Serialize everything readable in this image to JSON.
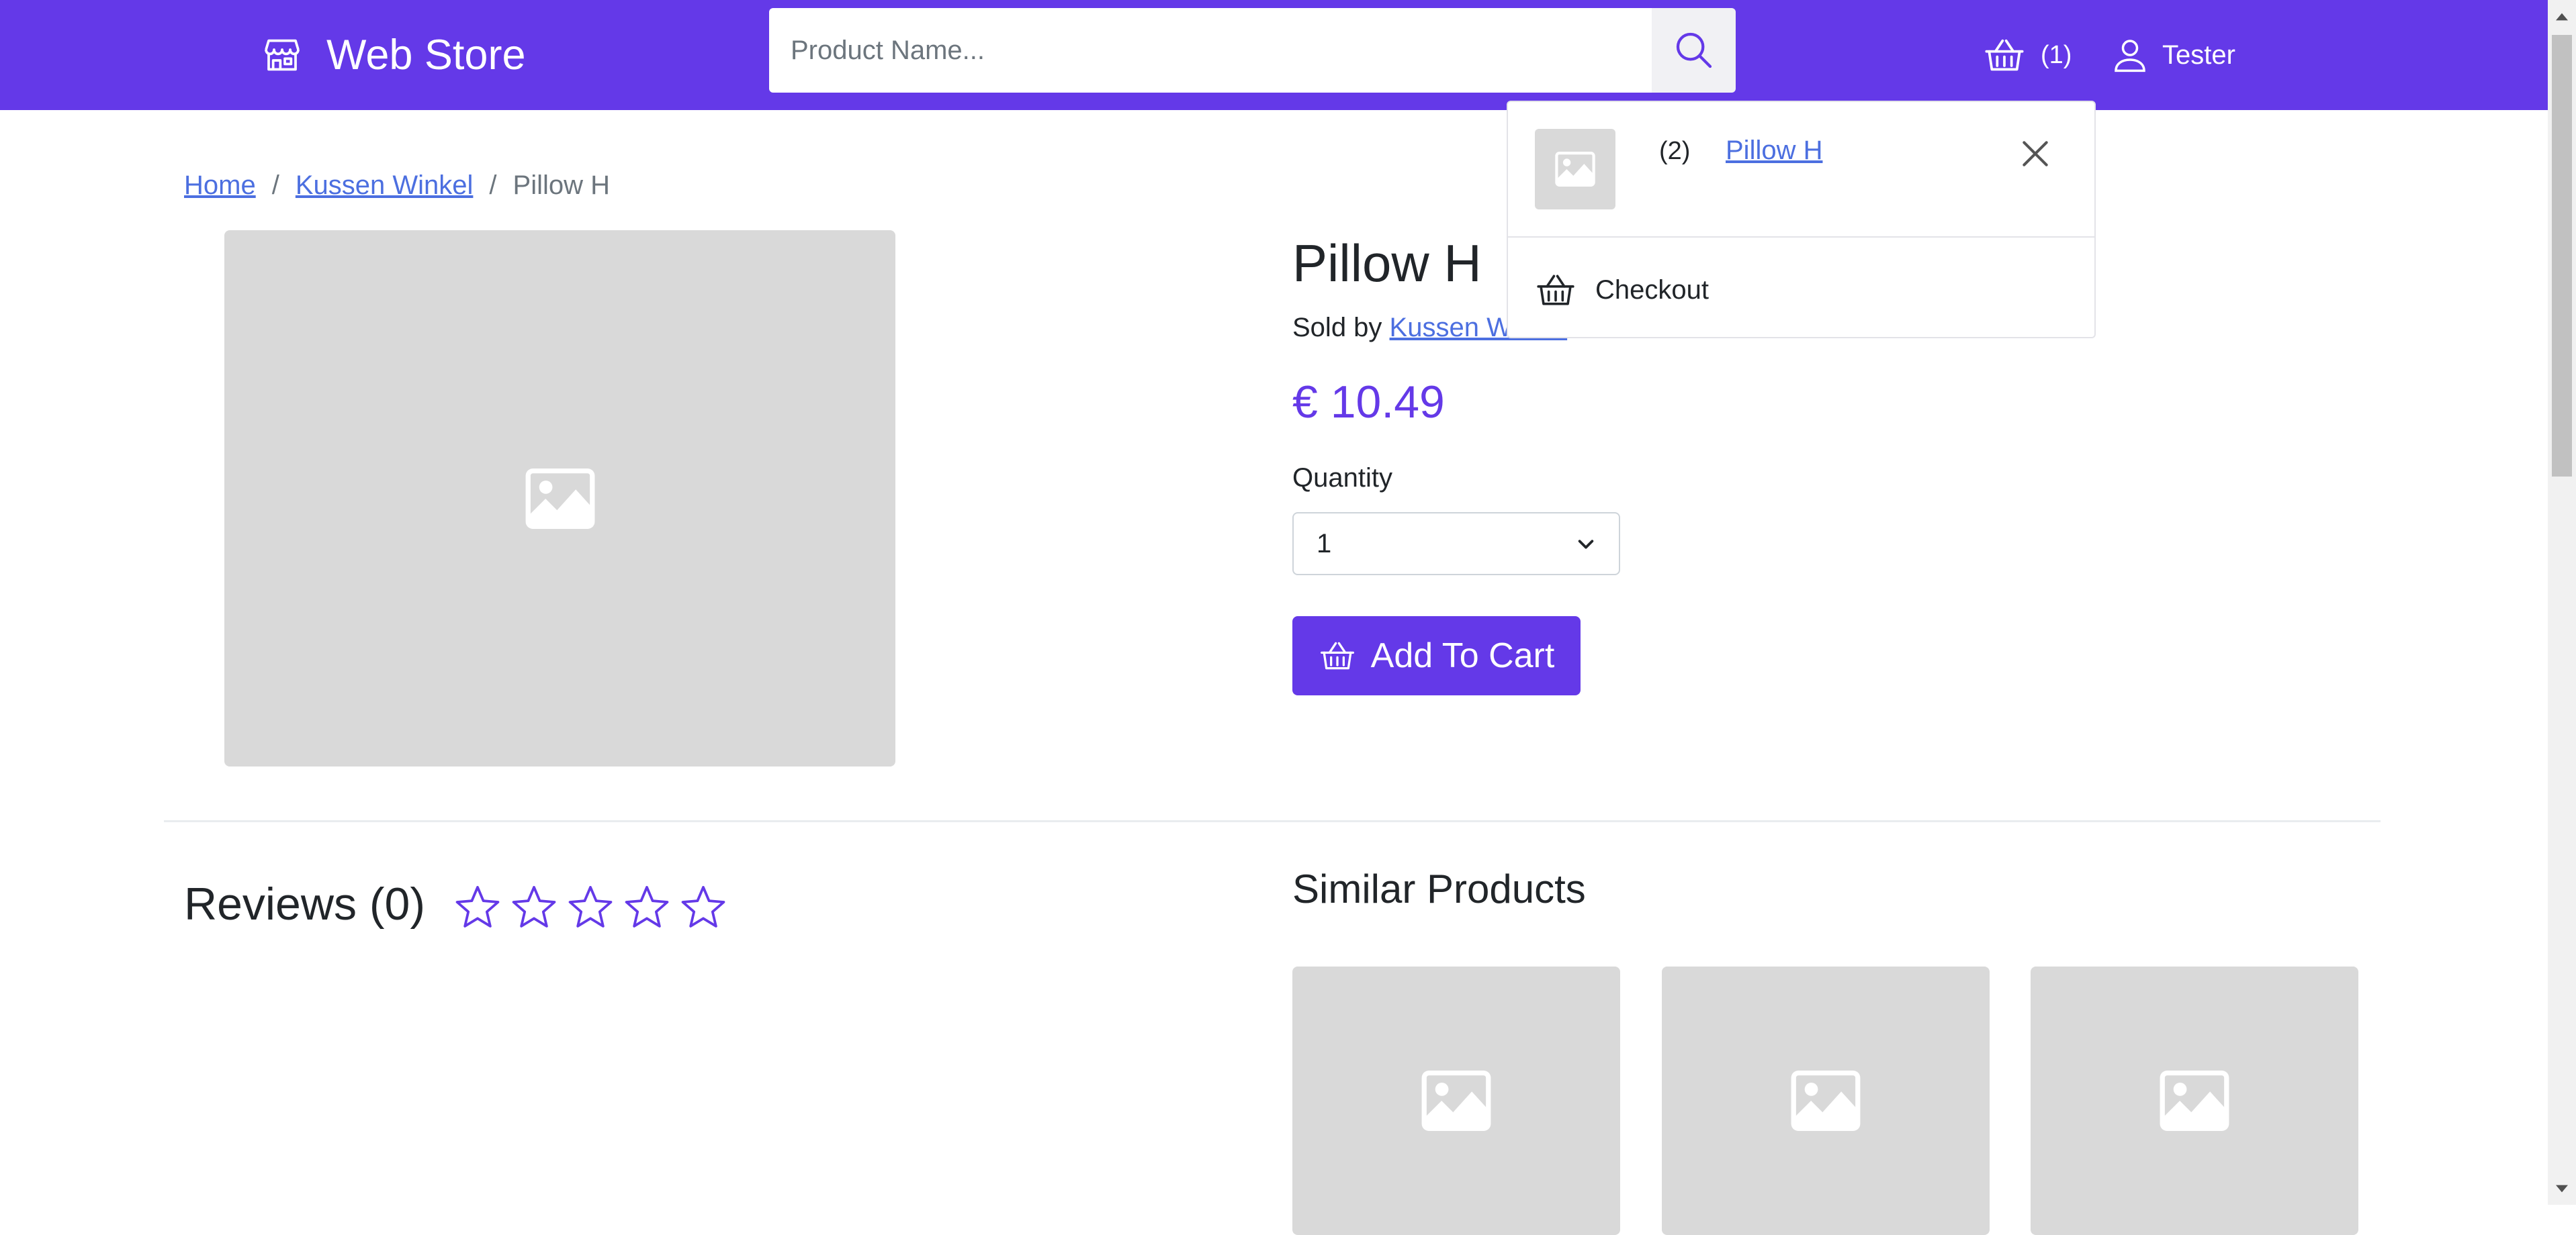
{
  "header": {
    "brand": "Web Store",
    "search_placeholder": "Product Name...",
    "cart_count": "(1)",
    "user_name": "Tester"
  },
  "breadcrumb": {
    "home": "Home",
    "store": "Kussen Winkel",
    "current": "Pillow H"
  },
  "product": {
    "title": "Pillow H",
    "sold_by_label": "Sold by",
    "seller": "Kussen Winkel",
    "price": "€ 10.49",
    "quantity_label": "Quantity",
    "quantity_value": "1",
    "add_to_cart": "Add To Cart"
  },
  "reviews": {
    "title": "Reviews (0)",
    "rating": 0,
    "max_rating": 5
  },
  "similar": {
    "title": "Similar Products"
  },
  "cart_dropdown": {
    "item_qty": "(2)",
    "item_name": "Pillow H",
    "checkout": "Checkout"
  },
  "colors": {
    "brand": "#6439e8",
    "link": "#4c6fe0",
    "placeholder_bg": "#d9d9d9"
  },
  "icons": {
    "brand": "store-icon",
    "search": "search-icon",
    "cart": "basket-icon",
    "user": "user-icon",
    "image": "image-icon",
    "close": "close-icon",
    "star": "star-outline-icon",
    "chevron": "chevron-down-icon"
  }
}
